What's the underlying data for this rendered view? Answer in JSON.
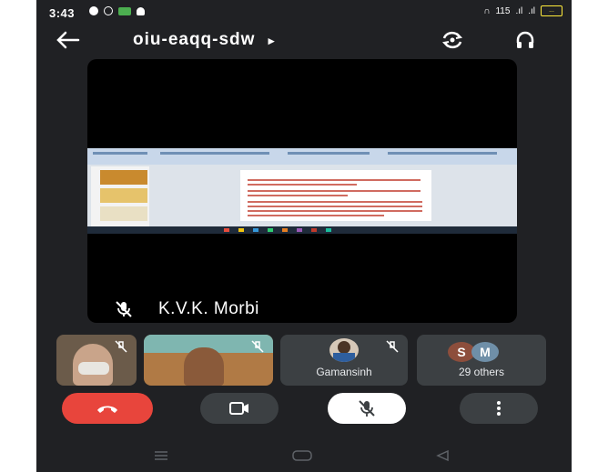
{
  "status_bar": {
    "time": "3:43",
    "network_speed": "115",
    "battery": "..."
  },
  "top_bar": {
    "meeting_code": "oiu-eaqq-sdw",
    "code_arrow": "▸"
  },
  "main_tile": {
    "participant_name": "K.V.K. Morbi"
  },
  "participants": [
    {
      "name": ""
    },
    {
      "name": ""
    },
    {
      "name": "Gamansinh"
    },
    {
      "name": "29 others",
      "avatars": [
        "S",
        "M"
      ]
    }
  ],
  "colors": {
    "background": "#202124",
    "end_call": "#e8453c",
    "control_dark": "#3c4043",
    "avatar_s": "#8d4e3c",
    "avatar_m": "#6f8fa8"
  },
  "controls": {
    "end_call": "end-call-icon",
    "camera": "video-camera-icon",
    "mic": "mic-off-icon",
    "more": "more-vert-icon"
  }
}
